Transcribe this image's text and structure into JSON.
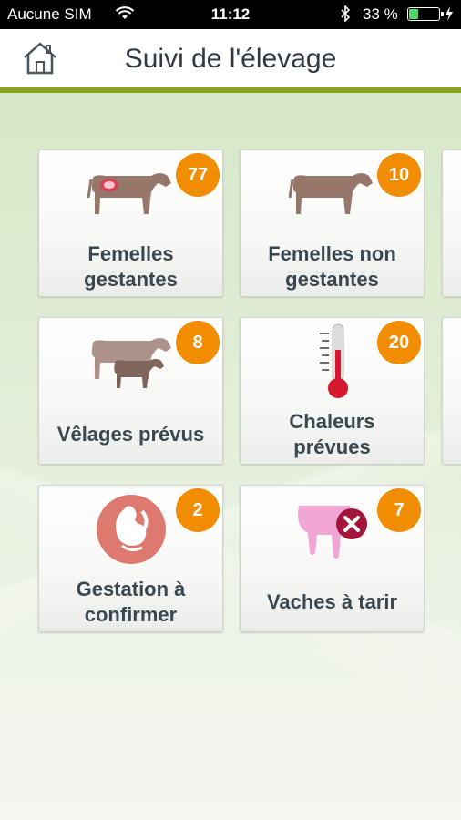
{
  "status_bar": {
    "carrier": "Aucune SIM",
    "time": "11:12",
    "battery_percent": "33 %",
    "battery_level": 0.33
  },
  "header": {
    "title": "Suivi de l'élevage",
    "accent_color": "#8ca11e"
  },
  "tiles": [
    {
      "line1": "Femelles",
      "line2": "gestantes",
      "count": "77",
      "icon": "pregnant-cow-icon"
    },
    {
      "line1": "Femelles non",
      "line2": "gestantes",
      "count": "10",
      "icon": "cow-icon"
    },
    {
      "line1": "Vêlages prévus",
      "line2": "",
      "count": "8",
      "icon": "cow-calf-icon"
    },
    {
      "line1": "Chaleurs",
      "line2": "prévues",
      "count": "20",
      "icon": "thermometer-icon"
    },
    {
      "line1": "Gestation à",
      "line2": "confirmer",
      "count": "2",
      "icon": "fetus-icon"
    },
    {
      "line1": "Vaches à tarir",
      "line2": "",
      "count": "7",
      "icon": "udder-dry-icon"
    }
  ],
  "badge_color": "#f28c00"
}
